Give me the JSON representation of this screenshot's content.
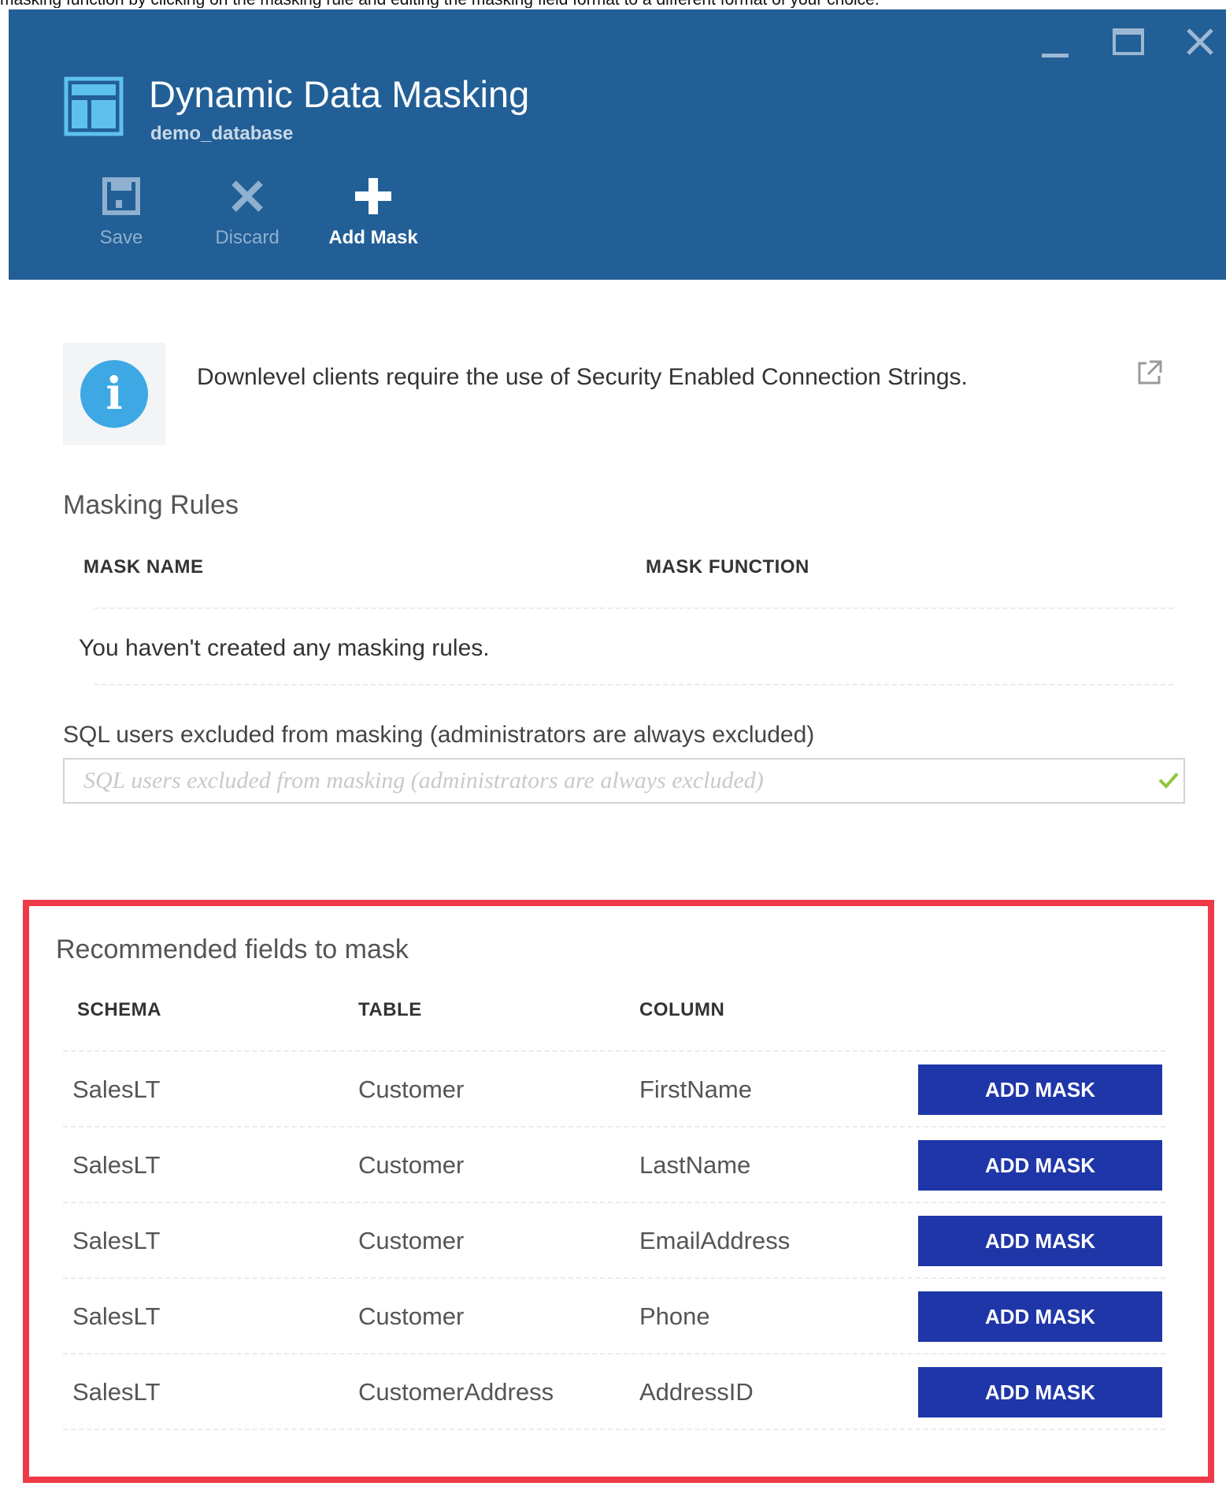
{
  "caption": "masking function by clicking on the masking rule and editing the masking field format to a different format of your choice.",
  "blade": {
    "title": "Dynamic Data Masking",
    "subtitle": "demo_database"
  },
  "commands": {
    "save": "Save",
    "discard": "Discard",
    "add_mask": "Add Mask"
  },
  "info": {
    "message": "Downlevel clients require the use of Security Enabled Connection Strings."
  },
  "masking_rules": {
    "heading": "Masking Rules",
    "columns": [
      "MASK NAME",
      "MASK FUNCTION"
    ],
    "empty_message": "You haven't created any masking rules."
  },
  "excluded_users": {
    "label": "SQL users excluded from masking (administrators are always excluded)",
    "placeholder": "SQL users excluded from masking (administrators are always excluded)",
    "value": ""
  },
  "recommended": {
    "heading": "Recommended fields to mask",
    "columns": [
      "SCHEMA",
      "TABLE",
      "COLUMN"
    ],
    "button_label": "ADD MASK",
    "rows": [
      {
        "schema": "SalesLT",
        "table": "Customer",
        "column": "FirstName"
      },
      {
        "schema": "SalesLT",
        "table": "Customer",
        "column": "LastName"
      },
      {
        "schema": "SalesLT",
        "table": "Customer",
        "column": "EmailAddress"
      },
      {
        "schema": "SalesLT",
        "table": "Customer",
        "column": "Phone"
      },
      {
        "schema": "SalesLT",
        "table": "CustomerAddress",
        "column": "AddressID"
      }
    ]
  },
  "icons": {
    "window": [
      "minimize-icon",
      "maximize-icon",
      "close-icon"
    ],
    "commands": [
      "save-icon",
      "discard-icon",
      "add-icon"
    ],
    "info": "info-icon",
    "link": "external-link-icon",
    "valid": "checkmark-icon"
  },
  "colors": {
    "header": "#225f96",
    "button": "#1f36a8",
    "highlight_frame": "#ee3a48",
    "info": "#3da8e3",
    "check": "#8cc63f"
  }
}
